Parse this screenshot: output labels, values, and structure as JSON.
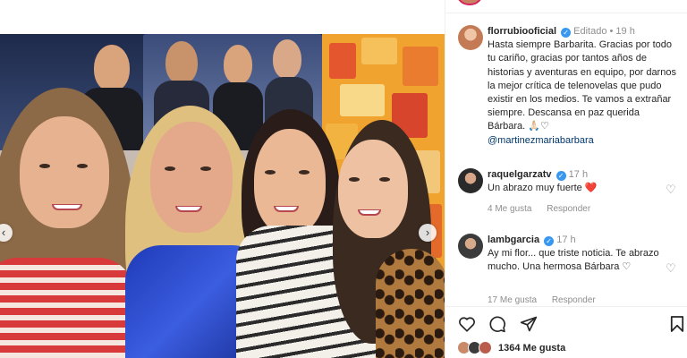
{
  "post": {
    "author": {
      "username": "florrubiooficial",
      "edited_label": "Editado",
      "separator": "•",
      "time": "19 h",
      "verified": true
    },
    "caption": "Hasta siempre Barbarita. Gracias por todo tu cariño, gracias por tantos años de historias y aventuras en equipo, por darnos la mejor crítica de telenovelas que pudo existir en los medios. Te vamos a extrañar siempre. Descansa en paz querida Bárbara. 🙏🏻♡",
    "mention": "@martinezmariabarbara"
  },
  "comments": [
    {
      "username": "raquelgarzatv",
      "verified": true,
      "time": "17 h",
      "text": "Un abrazo muy fuerte ❤️",
      "likes_label": "4 Me gusta",
      "reply_label": "Responder"
    },
    {
      "username": "lambgarcia",
      "verified": true,
      "time": "17 h",
      "text": "Ay mi flor... que triste noticia. Te abrazo mucho. Una hermosa Bárbara ♡",
      "likes_label": "17 Me gusta",
      "reply_label": "Responder"
    }
  ],
  "actions": {
    "like_icon": "heart-icon",
    "comment_icon": "comment-icon",
    "share_icon": "share-icon",
    "save_icon": "bookmark-icon"
  },
  "likes": {
    "label": "1364 Me gusta"
  },
  "carousel": {
    "prev_icon": "chevron-left-icon",
    "next_icon": "chevron-right-icon"
  },
  "colors": {
    "verified": "#3897f0",
    "link": "#00376b",
    "muted": "#8e8e8e",
    "text": "#262626",
    "heart_red": "#ed1d36"
  }
}
